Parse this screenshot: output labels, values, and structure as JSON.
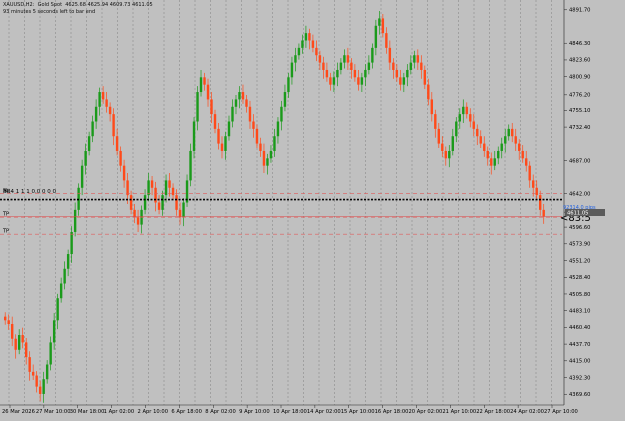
{
  "header": {
    "line1": "XAUUSD,H2:  Gold Spot  4625.68 4625.94 4609.73 4611.05",
    "line2": "93 minutes 5 seconds left to bar end"
  },
  "chart": {
    "background": "#c0c0c0",
    "bull_color": "#1a9a1a",
    "bear_color": "#ff4a1a",
    "vgrid_color": "#8a8a8a",
    "level_color": "#e05a5a",
    "overlay_label": "BB4 1 1 1 0.0 0 0 0"
  },
  "levels": [
    {
      "name": "SL",
      "label": "SL",
      "price": 4642.0
    },
    {
      "name": "entry",
      "label": "",
      "price": 4634.0
    },
    {
      "name": "current",
      "label": "",
      "price": 4611.0
    },
    {
      "name": "TP",
      "label": "TP",
      "price": 4610.0
    },
    {
      "name": "TP2",
      "label": "TP",
      "price": 4587.0
    }
  ],
  "markers": {
    "current_price_tag": "4611.05",
    "countdown": "<83:5",
    "blue_label": "92314.0 pips"
  },
  "chart_data": {
    "type": "candlestick",
    "x_ticks": [
      "26 Mar 2026",
      "27 Mar 10:00",
      "30 Mar 18:00",
      "1 Apr 02:00",
      "2 Apr 10:00",
      "6 Apr 18:00",
      "8 Apr 02:00",
      "9 Apr 10:00",
      "10 Apr 18:00",
      "14 Apr 02:00",
      "15 Apr 10:00",
      "16 Apr 18:00",
      "20 Apr 02:00",
      "21 Apr 10:00",
      "22 Apr 18:00",
      "24 Apr 02:00",
      "27 Apr 10:00"
    ],
    "y_ticks": [
      "4891.70",
      "4846.30",
      "4823.60",
      "4800.90",
      "4776.20",
      "4755.10",
      "4732.40",
      "4687.00",
      "4642.00",
      "4616.90",
      "4596.60",
      "4573.90",
      "4551.20",
      "4528.40",
      "4505.80",
      "4483.10",
      "4460.40",
      "4437.70",
      "4415.00",
      "4392.30",
      "4369.60"
    ],
    "ylim": [
      4355,
      4905
    ],
    "close_series": [
      4470,
      4465,
      4445,
      4430,
      4450,
      4440,
      4420,
      4400,
      4395,
      4380,
      4370,
      4390,
      4410,
      4440,
      4470,
      4500,
      4520,
      4540,
      4560,
      4590,
      4620,
      4650,
      4680,
      4700,
      4720,
      4740,
      4760,
      4780,
      4770,
      4760,
      4750,
      4720,
      4700,
      4680,
      4660,
      4640,
      4620,
      4610,
      4600,
      4620,
      4640,
      4660,
      4650,
      4630,
      4620,
      4640,
      4660,
      4650,
      4640,
      4620,
      4610,
      4630,
      4660,
      4700,
      4740,
      4780,
      4800,
      4790,
      4770,
      4750,
      4730,
      4710,
      4700,
      4720,
      4740,
      4760,
      4770,
      4780,
      4770,
      4760,
      4740,
      4730,
      4710,
      4700,
      4680,
      4690,
      4700,
      4720,
      4740,
      4760,
      4780,
      4800,
      4820,
      4830,
      4840,
      4850,
      4860,
      4850,
      4840,
      4830,
      4820,
      4810,
      4800,
      4790,
      4800,
      4810,
      4820,
      4830,
      4820,
      4810,
      4800,
      4790,
      4800,
      4810,
      4820,
      4840,
      4870,
      4880,
      4860,
      4840,
      4820,
      4810,
      4800,
      4790,
      4800,
      4810,
      4820,
      4830,
      4820,
      4810,
      4790,
      4770,
      4750,
      4730,
      4710,
      4700,
      4690,
      4700,
      4720,
      4740,
      4750,
      4760,
      4750,
      4740,
      4730,
      4720,
      4710,
      4700,
      4690,
      4680,
      4690,
      4700,
      4710,
      4720,
      4730,
      4720,
      4710,
      4700,
      4690,
      4680,
      4660,
      4650,
      4640,
      4620,
      4611
    ]
  }
}
